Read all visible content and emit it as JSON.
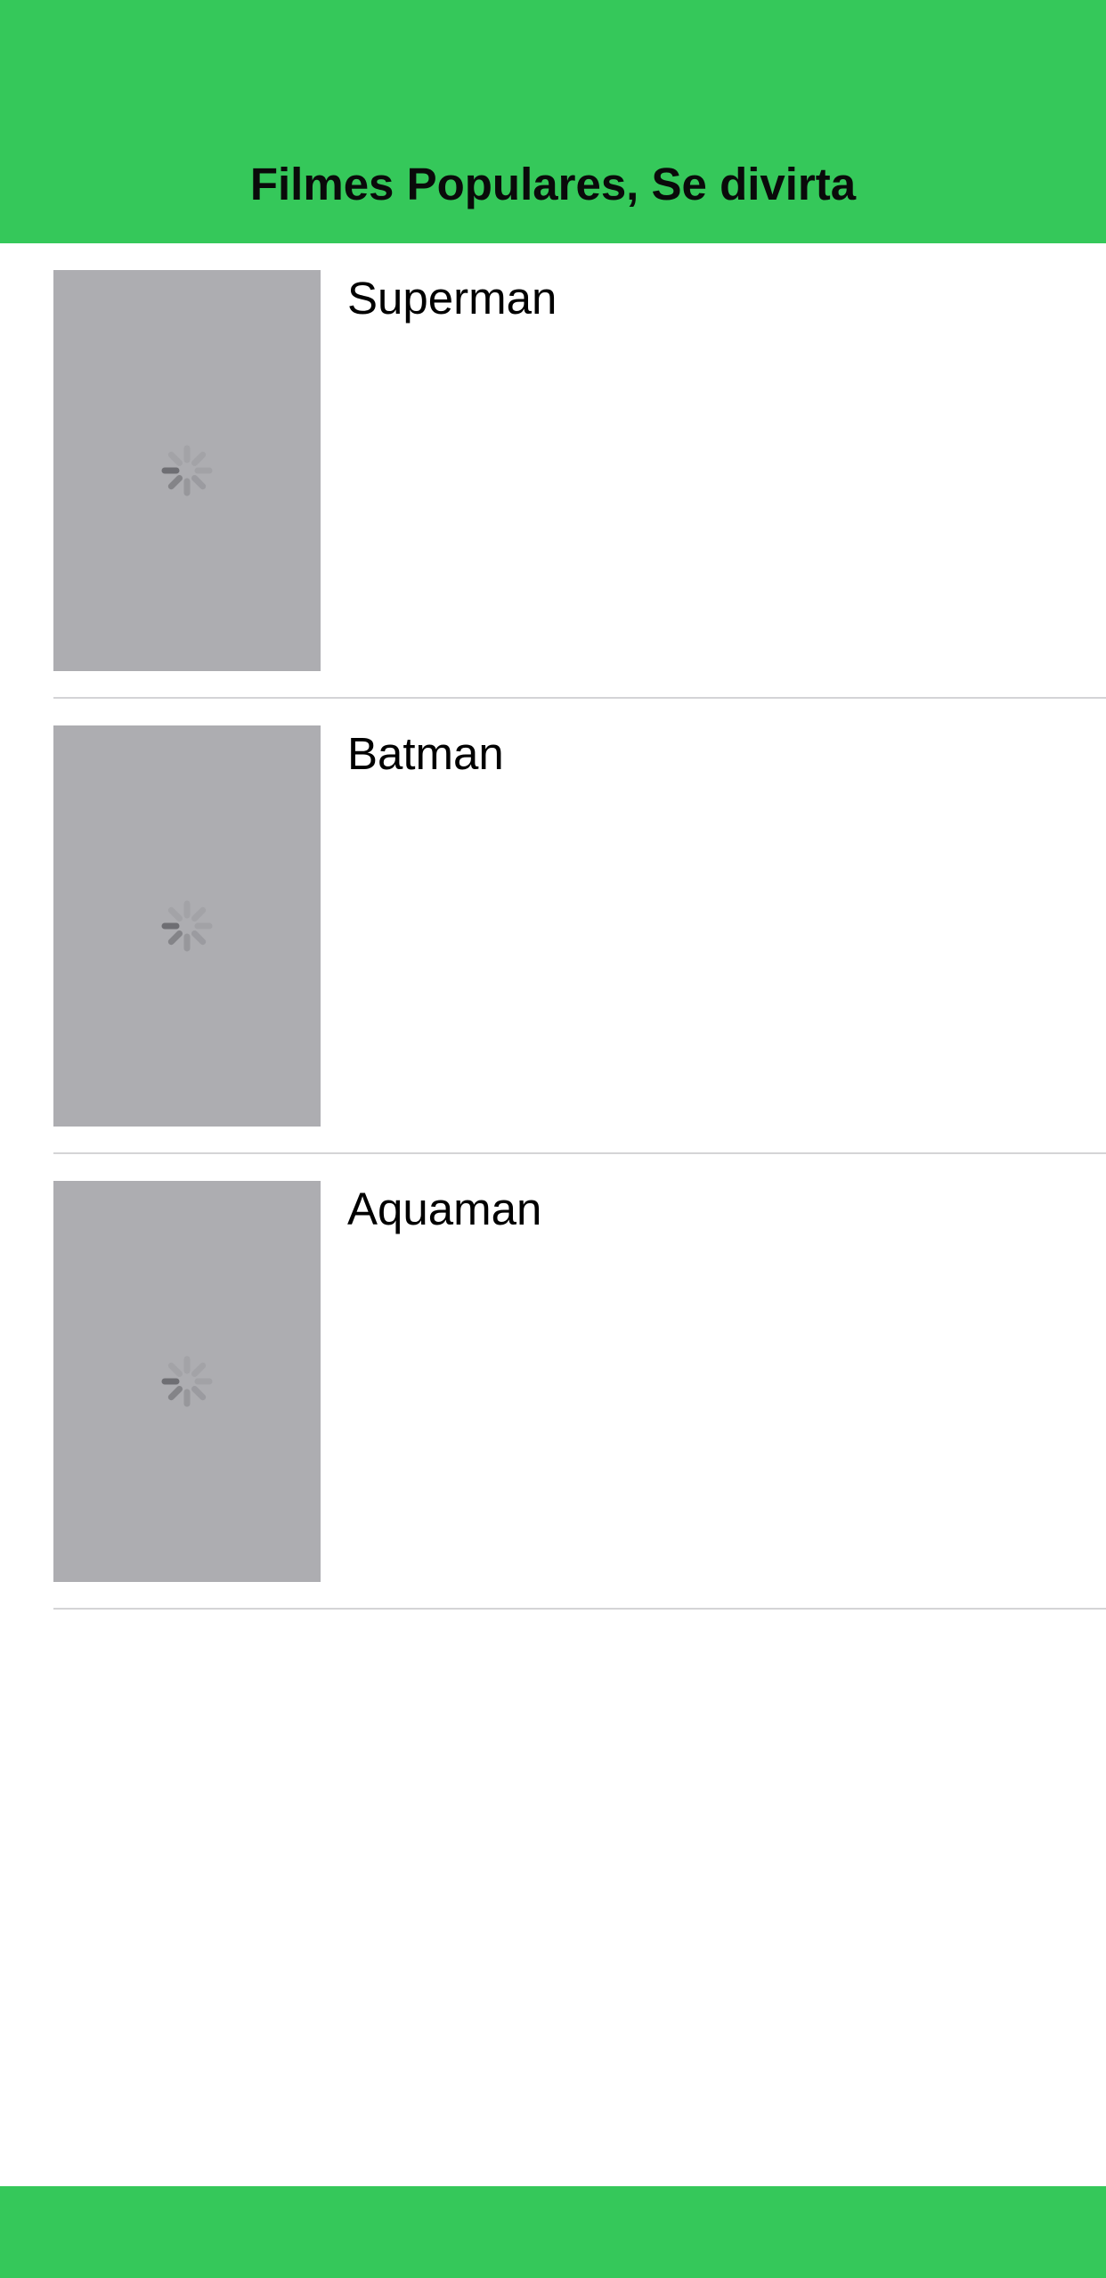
{
  "nav": {
    "title": "Filmes Populares, Se divirta"
  },
  "colors": {
    "accent": "#35c85a",
    "poster_placeholder": "#adadb1",
    "separator": "#d4d4d6"
  },
  "movies": [
    {
      "title": "Superman",
      "poster_state": "loading",
      "icon": "activity-spinner-icon"
    },
    {
      "title": "Batman",
      "poster_state": "loading",
      "icon": "activity-spinner-icon"
    },
    {
      "title": "Aquaman",
      "poster_state": "loading",
      "icon": "activity-spinner-icon"
    }
  ]
}
